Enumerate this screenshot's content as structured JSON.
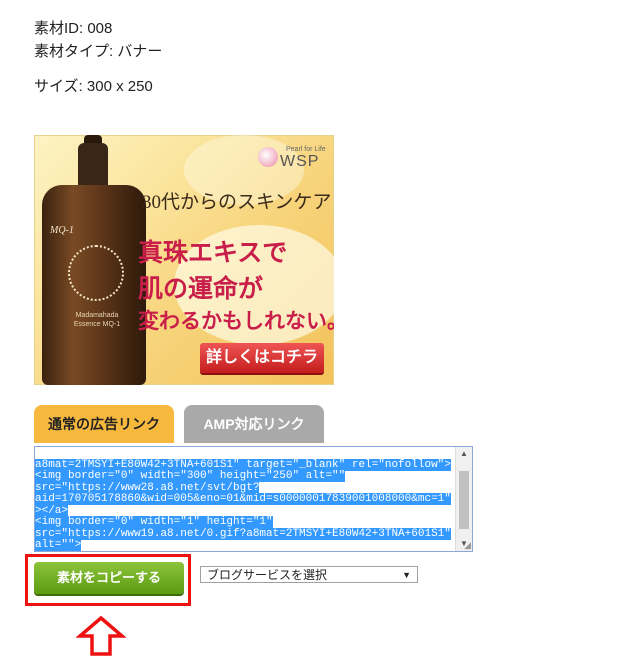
{
  "meta": {
    "id_line": "素材ID: 008",
    "type_line": "素材タイプ: バナー",
    "size_line": "サイズ: 300 x 250"
  },
  "banner": {
    "tagline": "30代からのスキンケア",
    "headline_1": "真珠エキスで",
    "headline_2": "肌の運命が",
    "headline_3": "変わるかもしれない。",
    "cta": "詳しくはコチラ",
    "logo_small": "Pearl for Life",
    "logo_big": "WSP",
    "bottle_label": "MQ-1",
    "bottle_text": "Madamahada Essence MQ-1"
  },
  "tabs": [
    {
      "label": "通常の広告リンク",
      "active": true
    },
    {
      "label": "AMP対応リンク",
      "active": false
    }
  ],
  "code": {
    "lines": [
      "a8mat=2TMSYI+E80W42+3TNA+601S1\" target=\"_blank\" rel=\"nofollow\">",
      "<img border=\"0\" width=\"300\" height=\"250\" alt=\"\"",
      "src=\"https://www28.a8.net/svt/bgt?",
      "aid=170705178860&wid=005&eno=01&mid=s00000017839001008000&mc=1\"",
      "></a>",
      "<img border=\"0\" width=\"1\" height=\"1\"",
      "src=\"https://www19.a8.net/0.gif?a8mat=2TMSYI+E80W42+3TNA+601S1\"",
      "alt=\"\">"
    ]
  },
  "copy_button": "素材をコピーする",
  "blog_select": {
    "selected": "ブログサービスを選択"
  },
  "colors": {
    "tab_active": "#f6b93e",
    "tab_inactive": "#a9a9a9",
    "copy_button": "#6aa81e",
    "highlight": "#ee1111",
    "selection": "#3399ff"
  }
}
